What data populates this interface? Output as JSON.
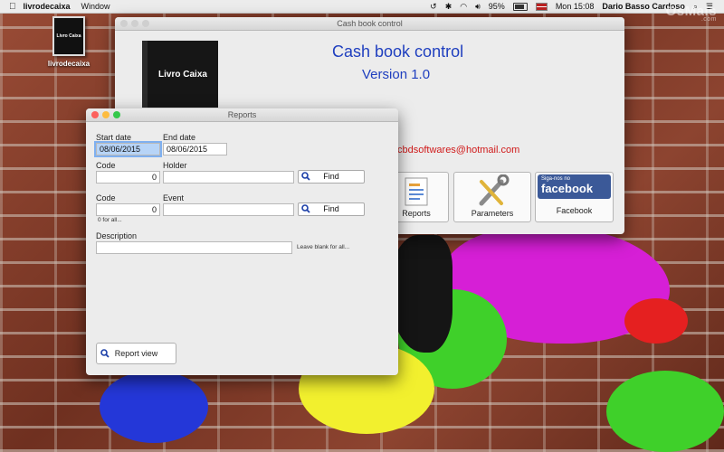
{
  "menubar": {
    "app_name": "livrodecaixa",
    "menu_window": "Window",
    "battery_percent": "95%",
    "clock": "Mon 15:08",
    "user_name": "Dario Basso Cardoso"
  },
  "watermark": {
    "brand": "OsMais",
    "domain": ".com"
  },
  "desktop": {
    "icon_label": "livrodecaixa",
    "icon_book_text": "Livro Caixa"
  },
  "main_window": {
    "title": "Cash book control",
    "heading": "Cash book control",
    "version": "Version 1.0",
    "book_text": "Livro Caixa",
    "email_visible": "cbdsoftwares@hotmail.com",
    "buttons": {
      "reports": "Reports",
      "parameters": "Parameters",
      "facebook": "Facebook",
      "facebook_badge_top": "Siga-nos no",
      "facebook_badge_main": "facebook"
    }
  },
  "reports_window": {
    "title": "Reports",
    "start_date_label": "Start date",
    "start_date_value": "08/06/2015",
    "end_date_label": "End date",
    "end_date_value": "08/06/2015",
    "code_label_1": "Code",
    "code_value_1": "0",
    "holder_label": "Holder",
    "holder_value": "",
    "find_label": "Find",
    "code_label_2": "Code",
    "code_value_2": "0",
    "code_hint": "0 for all...",
    "event_label": "Event",
    "event_value": "",
    "description_label": "Description",
    "description_value": "",
    "description_hint": "Leave blank for all...",
    "report_view_label": "Report view"
  },
  "colors": {
    "title_blue": "#1f3fbf",
    "email_red": "#d01a1a",
    "facebook_blue": "#3b5998",
    "close_red": "#fc605c",
    "minimize_yellow": "#fdbc40",
    "zoom_green": "#34c84a"
  }
}
